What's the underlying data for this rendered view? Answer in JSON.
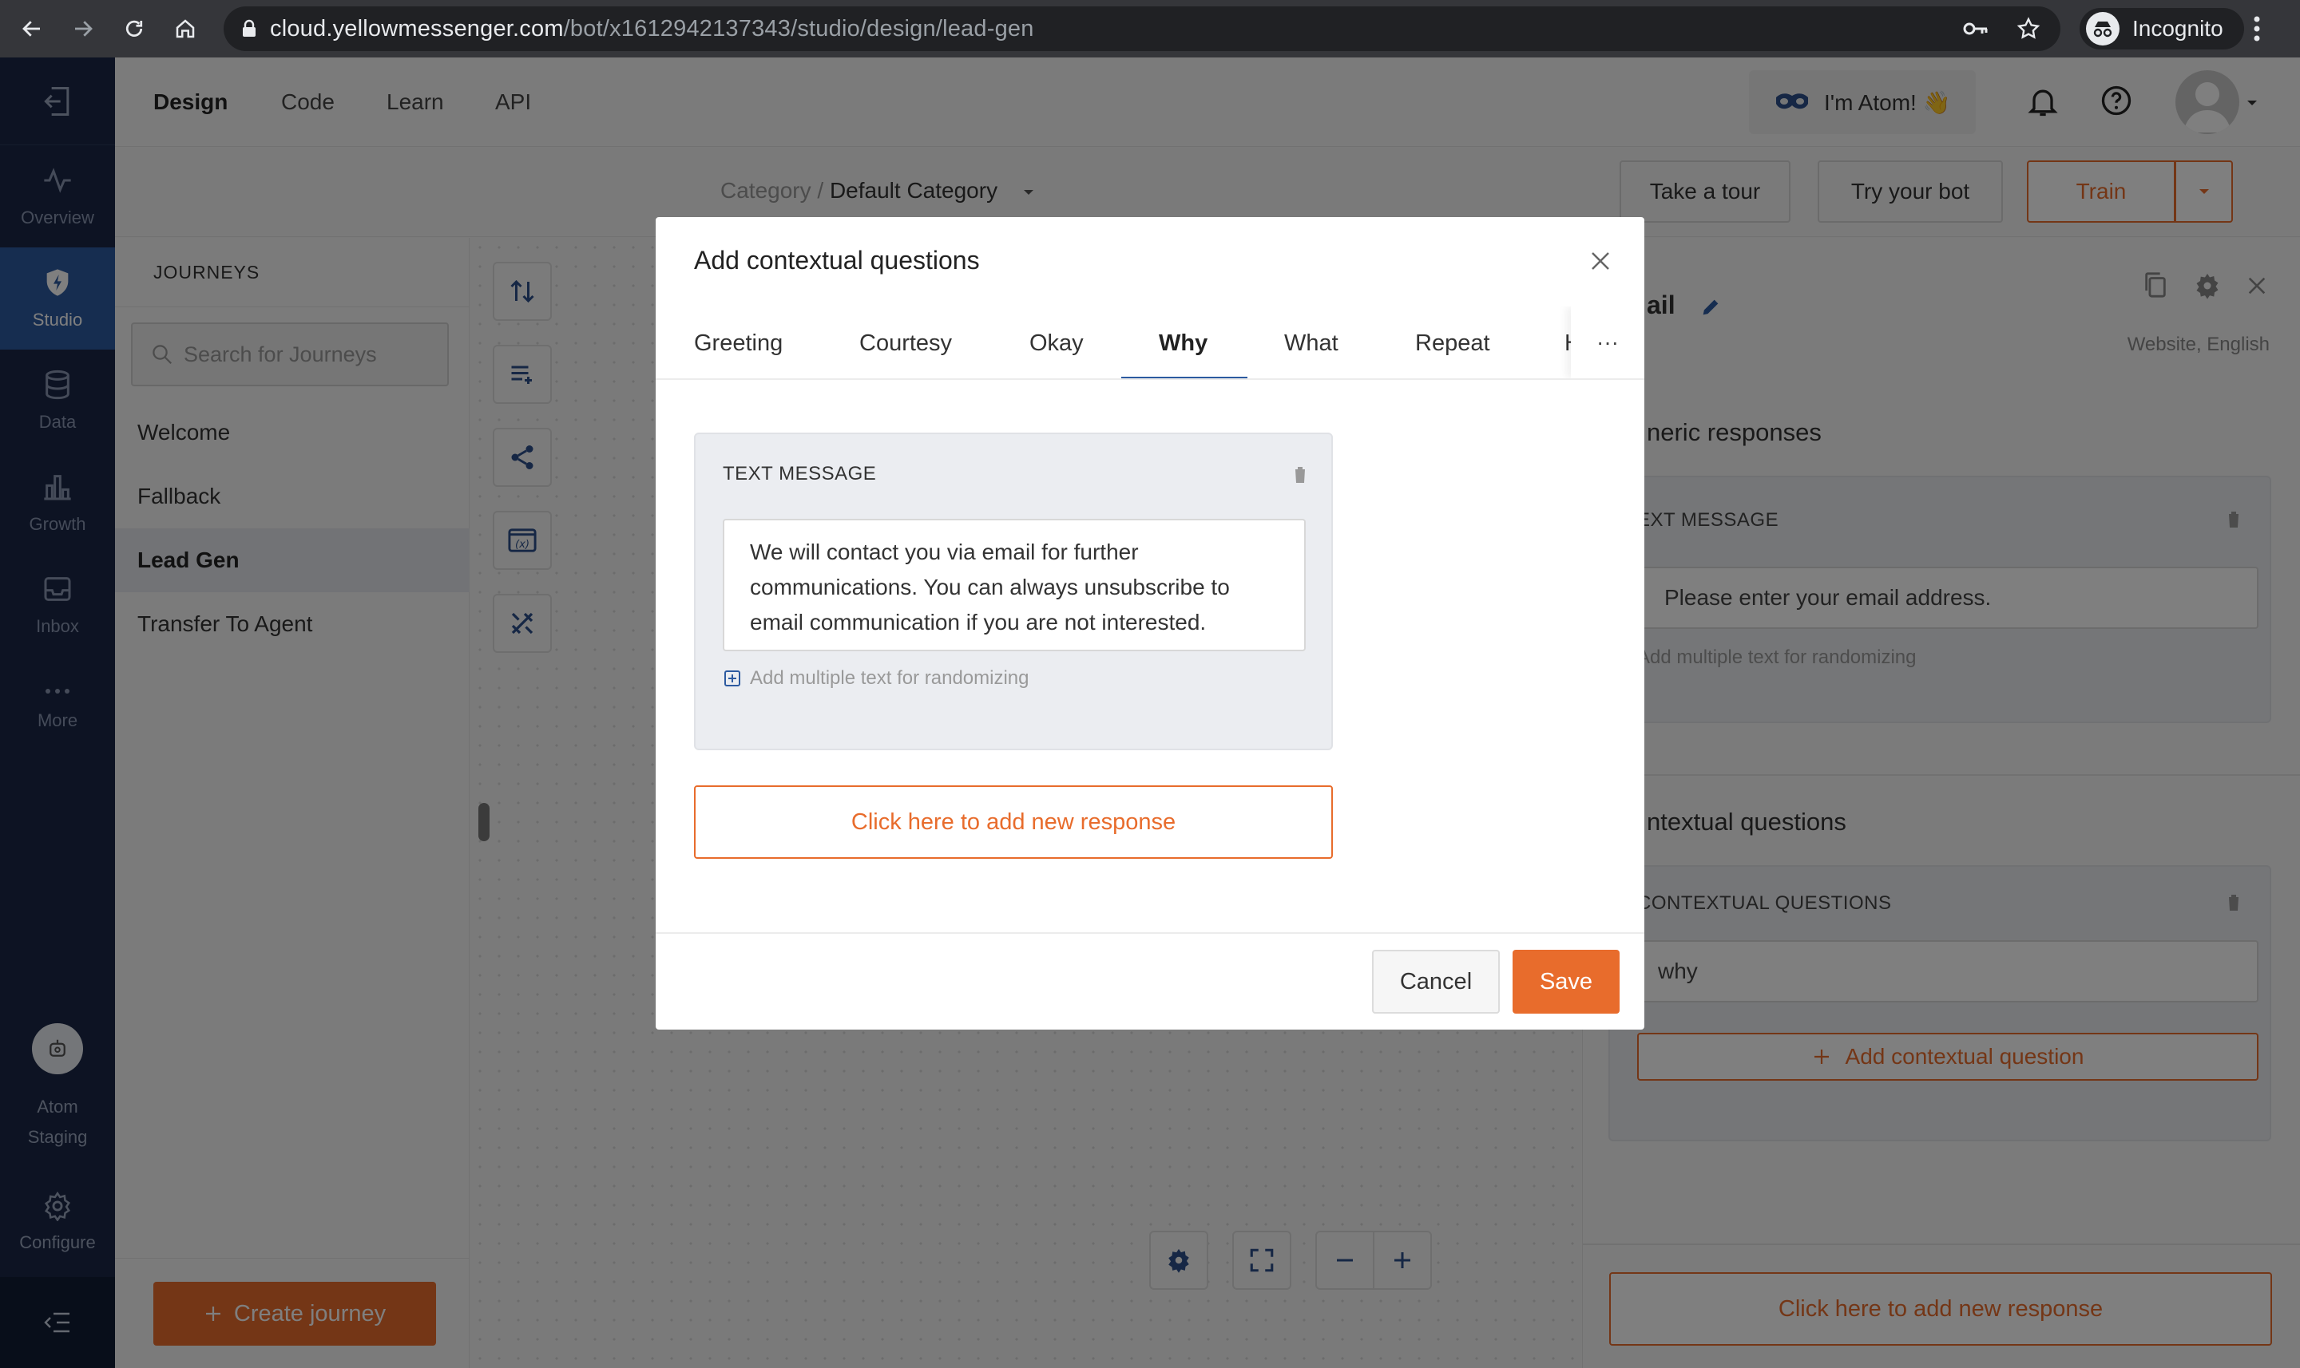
{
  "browser": {
    "url_host": "cloud.yellowmessenger.com",
    "url_path": "/bot/x1612942137343/studio/design/lead-gen",
    "incognito_label": "Incognito"
  },
  "leftnav": {
    "items": [
      {
        "label": "Overview",
        "icon": "activity-icon"
      },
      {
        "label": "Studio",
        "icon": "shield-bolt-icon"
      },
      {
        "label": "Data",
        "icon": "database-icon"
      },
      {
        "label": "Growth",
        "icon": "bar-chart-icon"
      },
      {
        "label": "Inbox",
        "icon": "inbox-icon"
      },
      {
        "label": "More",
        "icon": "ellipsis-icon"
      }
    ],
    "atom_line1": "Atom",
    "atom_line2": "Staging",
    "configure": "Configure"
  },
  "header": {
    "tabs": [
      "Design",
      "Code",
      "Learn",
      "API"
    ],
    "atom_chip": "I'm Atom! 👋"
  },
  "subheader": {
    "breadcrumb_parent": "Category /",
    "breadcrumb_current": "Default Category",
    "take_tour": "Take a tour",
    "try_bot": "Try your bot",
    "train": "Train"
  },
  "journeys": {
    "title": "JOURNEYS",
    "search_placeholder": "Search for Journeys",
    "items": [
      "Welcome",
      "Fallback",
      "Lead Gen",
      "Transfer To Agent"
    ],
    "create": "Create journey"
  },
  "rpanel": {
    "title": "ail",
    "subtitle": "Website, English",
    "generic_title": "neric responses",
    "text_message_label": "EXT MESSAGE",
    "text_message_value": "Please enter your email address.",
    "add_multiple": "Add multiple text for randomizing",
    "contextual_title": "ntextual questions",
    "contextual_label": "CONTEXTUAL QUESTIONS",
    "contextual_value": "why",
    "add_contextual": "Add contextual question",
    "new_response": "Click here to add new response"
  },
  "modal": {
    "title": "Add contextual questions",
    "tabs": [
      "Greeting",
      "Courtesy",
      "Okay",
      "Why",
      "What",
      "Repeat",
      "H"
    ],
    "more": "···",
    "card_label": "TEXT MESSAGE",
    "message": "We will contact you via email for further communications. You can always unsubscribe to email communication if you are not interested.",
    "add_multiple": "Add multiple text for randomizing",
    "new_response": "Click here to add new response",
    "cancel": "Cancel",
    "save": "Save"
  },
  "colors": {
    "accent": "#e86c2c",
    "nav_bg": "#1a2746",
    "nav_active": "#2c5aa0",
    "tab_underline": "#2c5aa0"
  }
}
